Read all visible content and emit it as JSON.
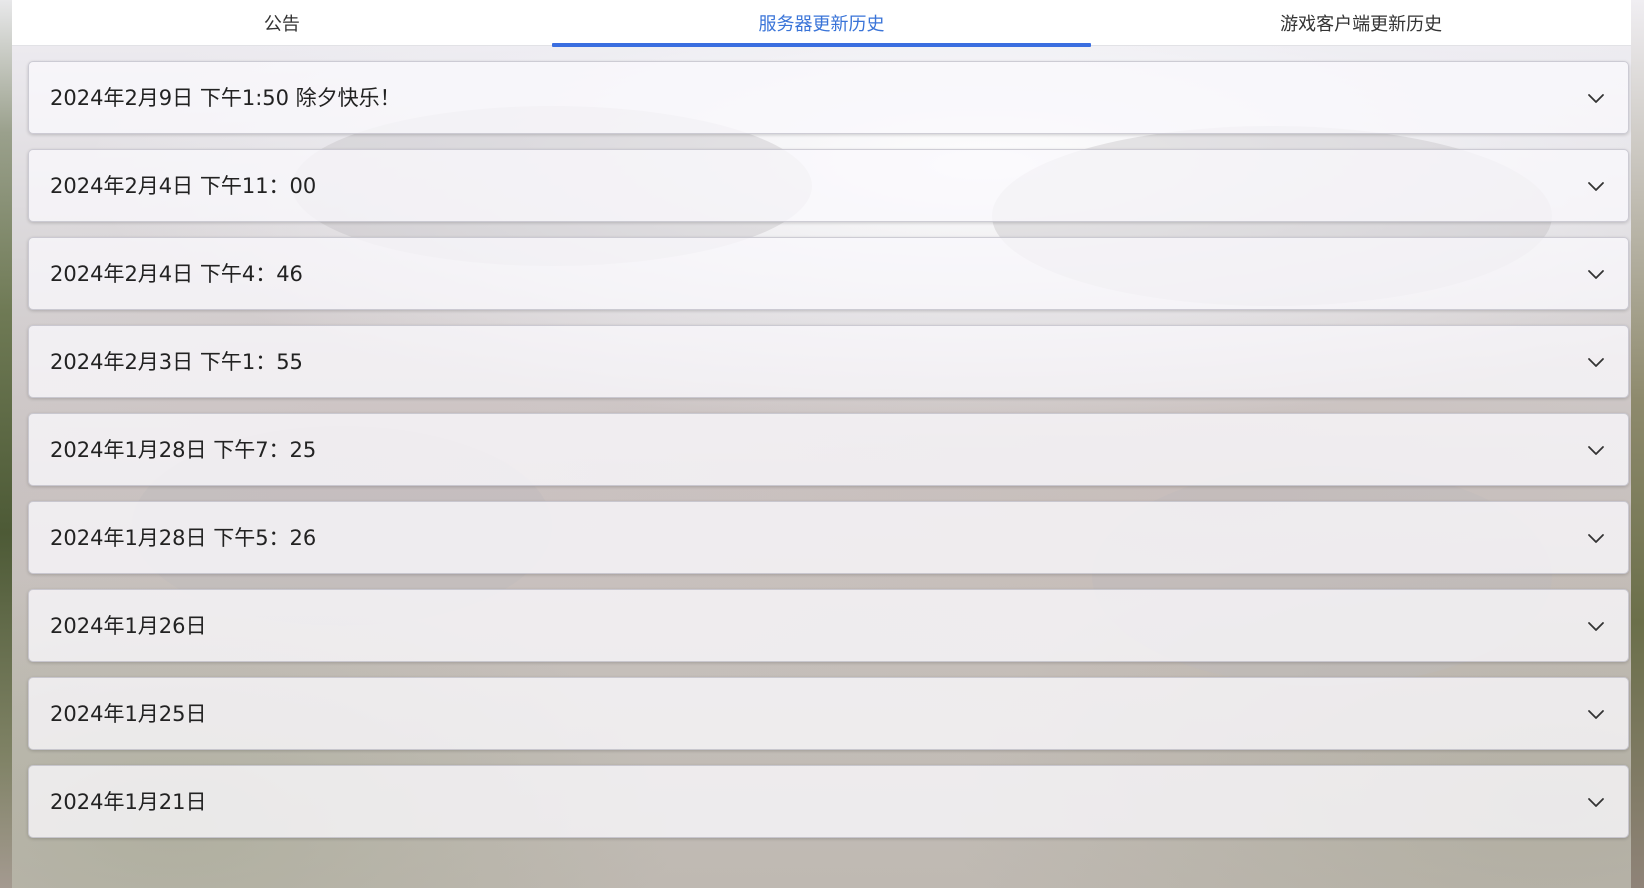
{
  "tabs": [
    {
      "label": "公告",
      "active": false
    },
    {
      "label": "服务器更新历史",
      "active": true
    },
    {
      "label": "游戏客户端更新历史",
      "active": false
    }
  ],
  "accent_color": "#3a6ee0",
  "items": [
    {
      "title": "2024年2月9日 下午1:50 除夕快乐！"
    },
    {
      "title": "2024年2月4日 下午11：00"
    },
    {
      "title": "2024年2月4日 下午4：46"
    },
    {
      "title": "2024年2月3日 下午1：55"
    },
    {
      "title": "2024年1月28日 下午7：25"
    },
    {
      "title": "2024年1月28日 下午5：26"
    },
    {
      "title": "2024年1月26日"
    },
    {
      "title": "2024年1月25日"
    },
    {
      "title": "2024年1月21日"
    }
  ],
  "icons": {
    "expand": "chevron-down-icon"
  }
}
